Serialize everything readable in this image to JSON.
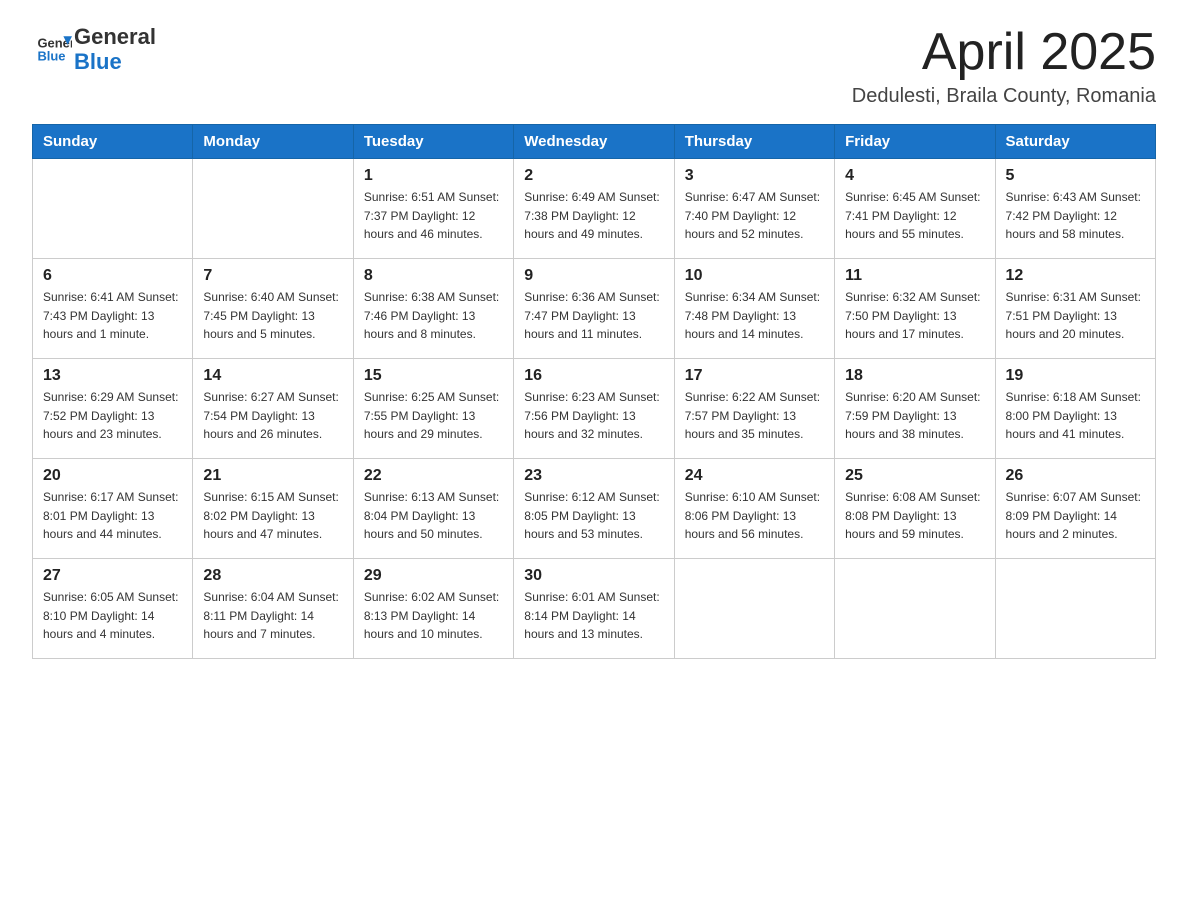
{
  "header": {
    "logo_general": "General",
    "logo_blue": "Blue",
    "month_title": "April 2025",
    "location": "Dedulesti, Braila County, Romania"
  },
  "weekdays": [
    "Sunday",
    "Monday",
    "Tuesday",
    "Wednesday",
    "Thursday",
    "Friday",
    "Saturday"
  ],
  "weeks": [
    [
      {
        "day": "",
        "info": ""
      },
      {
        "day": "",
        "info": ""
      },
      {
        "day": "1",
        "info": "Sunrise: 6:51 AM\nSunset: 7:37 PM\nDaylight: 12 hours\nand 46 minutes."
      },
      {
        "day": "2",
        "info": "Sunrise: 6:49 AM\nSunset: 7:38 PM\nDaylight: 12 hours\nand 49 minutes."
      },
      {
        "day": "3",
        "info": "Sunrise: 6:47 AM\nSunset: 7:40 PM\nDaylight: 12 hours\nand 52 minutes."
      },
      {
        "day": "4",
        "info": "Sunrise: 6:45 AM\nSunset: 7:41 PM\nDaylight: 12 hours\nand 55 minutes."
      },
      {
        "day": "5",
        "info": "Sunrise: 6:43 AM\nSunset: 7:42 PM\nDaylight: 12 hours\nand 58 minutes."
      }
    ],
    [
      {
        "day": "6",
        "info": "Sunrise: 6:41 AM\nSunset: 7:43 PM\nDaylight: 13 hours\nand 1 minute."
      },
      {
        "day": "7",
        "info": "Sunrise: 6:40 AM\nSunset: 7:45 PM\nDaylight: 13 hours\nand 5 minutes."
      },
      {
        "day": "8",
        "info": "Sunrise: 6:38 AM\nSunset: 7:46 PM\nDaylight: 13 hours\nand 8 minutes."
      },
      {
        "day": "9",
        "info": "Sunrise: 6:36 AM\nSunset: 7:47 PM\nDaylight: 13 hours\nand 11 minutes."
      },
      {
        "day": "10",
        "info": "Sunrise: 6:34 AM\nSunset: 7:48 PM\nDaylight: 13 hours\nand 14 minutes."
      },
      {
        "day": "11",
        "info": "Sunrise: 6:32 AM\nSunset: 7:50 PM\nDaylight: 13 hours\nand 17 minutes."
      },
      {
        "day": "12",
        "info": "Sunrise: 6:31 AM\nSunset: 7:51 PM\nDaylight: 13 hours\nand 20 minutes."
      }
    ],
    [
      {
        "day": "13",
        "info": "Sunrise: 6:29 AM\nSunset: 7:52 PM\nDaylight: 13 hours\nand 23 minutes."
      },
      {
        "day": "14",
        "info": "Sunrise: 6:27 AM\nSunset: 7:54 PM\nDaylight: 13 hours\nand 26 minutes."
      },
      {
        "day": "15",
        "info": "Sunrise: 6:25 AM\nSunset: 7:55 PM\nDaylight: 13 hours\nand 29 minutes."
      },
      {
        "day": "16",
        "info": "Sunrise: 6:23 AM\nSunset: 7:56 PM\nDaylight: 13 hours\nand 32 minutes."
      },
      {
        "day": "17",
        "info": "Sunrise: 6:22 AM\nSunset: 7:57 PM\nDaylight: 13 hours\nand 35 minutes."
      },
      {
        "day": "18",
        "info": "Sunrise: 6:20 AM\nSunset: 7:59 PM\nDaylight: 13 hours\nand 38 minutes."
      },
      {
        "day": "19",
        "info": "Sunrise: 6:18 AM\nSunset: 8:00 PM\nDaylight: 13 hours\nand 41 minutes."
      }
    ],
    [
      {
        "day": "20",
        "info": "Sunrise: 6:17 AM\nSunset: 8:01 PM\nDaylight: 13 hours\nand 44 minutes."
      },
      {
        "day": "21",
        "info": "Sunrise: 6:15 AM\nSunset: 8:02 PM\nDaylight: 13 hours\nand 47 minutes."
      },
      {
        "day": "22",
        "info": "Sunrise: 6:13 AM\nSunset: 8:04 PM\nDaylight: 13 hours\nand 50 minutes."
      },
      {
        "day": "23",
        "info": "Sunrise: 6:12 AM\nSunset: 8:05 PM\nDaylight: 13 hours\nand 53 minutes."
      },
      {
        "day": "24",
        "info": "Sunrise: 6:10 AM\nSunset: 8:06 PM\nDaylight: 13 hours\nand 56 minutes."
      },
      {
        "day": "25",
        "info": "Sunrise: 6:08 AM\nSunset: 8:08 PM\nDaylight: 13 hours\nand 59 minutes."
      },
      {
        "day": "26",
        "info": "Sunrise: 6:07 AM\nSunset: 8:09 PM\nDaylight: 14 hours\nand 2 minutes."
      }
    ],
    [
      {
        "day": "27",
        "info": "Sunrise: 6:05 AM\nSunset: 8:10 PM\nDaylight: 14 hours\nand 4 minutes."
      },
      {
        "day": "28",
        "info": "Sunrise: 6:04 AM\nSunset: 8:11 PM\nDaylight: 14 hours\nand 7 minutes."
      },
      {
        "day": "29",
        "info": "Sunrise: 6:02 AM\nSunset: 8:13 PM\nDaylight: 14 hours\nand 10 minutes."
      },
      {
        "day": "30",
        "info": "Sunrise: 6:01 AM\nSunset: 8:14 PM\nDaylight: 14 hours\nand 13 minutes."
      },
      {
        "day": "",
        "info": ""
      },
      {
        "day": "",
        "info": ""
      },
      {
        "day": "",
        "info": ""
      }
    ]
  ]
}
